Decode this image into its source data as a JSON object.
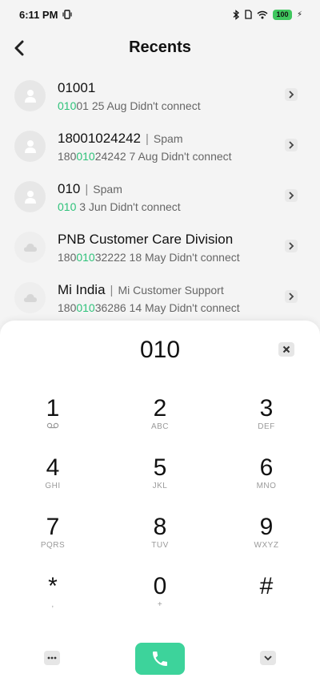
{
  "status": {
    "time": "6:11 PM",
    "battery": "100"
  },
  "header": {
    "title": "Recents"
  },
  "recents": [
    {
      "name": "01001",
      "label": "",
      "pre": "",
      "match": "010",
      "post": "01",
      "date": "25 Aug",
      "status": "Didn't connect"
    },
    {
      "name": "18001024242",
      "label": "Spam",
      "pre": "180",
      "match": "010",
      "post": "24242",
      "date": "7 Aug",
      "status": "Didn't connect"
    },
    {
      "name": "010",
      "label": "Spam",
      "pre": "",
      "match": "010",
      "post": "",
      "date": "3 Jun",
      "status": "Didn't connect"
    },
    {
      "name": "PNB Customer Care Division",
      "label": "",
      "pre": "180",
      "match": "010",
      "post": "32222",
      "date": "18 May",
      "status": "Didn't connect"
    },
    {
      "name": "Mi India",
      "label": "Mi Customer Support",
      "pre": "180",
      "match": "010",
      "post": "36286",
      "date": "14 May",
      "status": "Didn't connect"
    }
  ],
  "dialer": {
    "input": "010",
    "keys": [
      {
        "digit": "1",
        "letters": ""
      },
      {
        "digit": "2",
        "letters": "ABC"
      },
      {
        "digit": "3",
        "letters": "DEF"
      },
      {
        "digit": "4",
        "letters": "GHI"
      },
      {
        "digit": "5",
        "letters": "JKL"
      },
      {
        "digit": "6",
        "letters": "MNO"
      },
      {
        "digit": "7",
        "letters": "PQRS"
      },
      {
        "digit": "8",
        "letters": "TUV"
      },
      {
        "digit": "9",
        "letters": "WXYZ"
      },
      {
        "digit": "*",
        "letters": ","
      },
      {
        "digit": "0",
        "letters": "+"
      },
      {
        "digit": "#",
        "letters": ""
      }
    ]
  },
  "colors": {
    "accent": "#2ec27a",
    "call_button": "#3dd39b"
  }
}
